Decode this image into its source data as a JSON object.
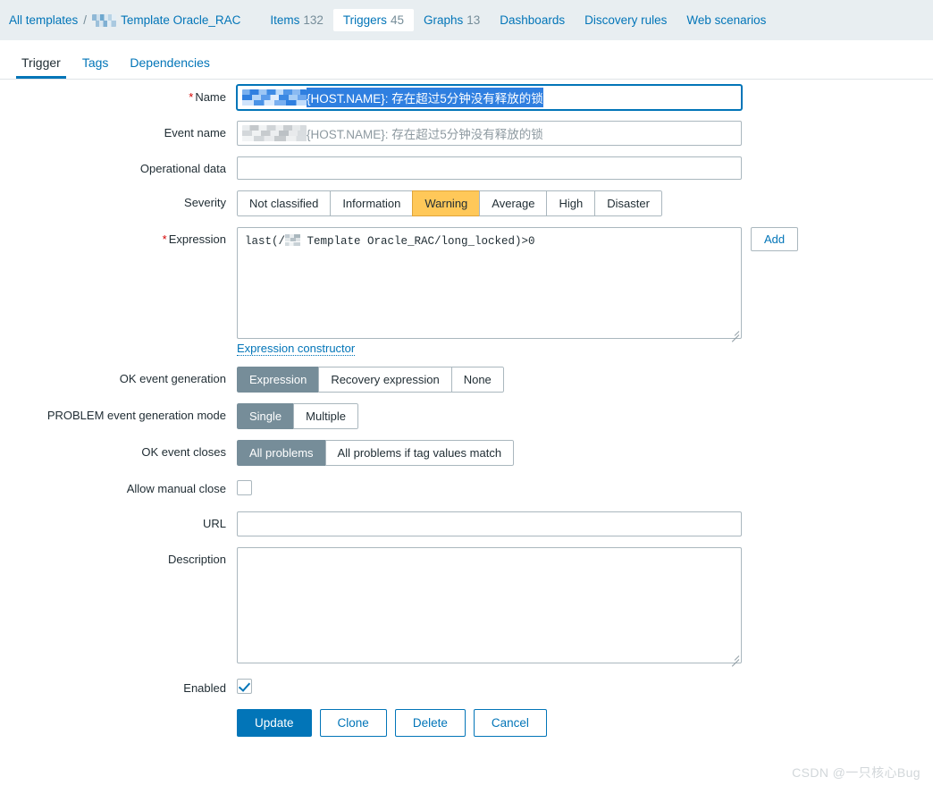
{
  "breadcrumb": {
    "all_templates_label": "All templates",
    "separator": "/",
    "template_name": "Template Oracle_RAC",
    "redacted_icon": "blurred-redaction-block"
  },
  "object_tabs": [
    {
      "label": "Items",
      "count": "132",
      "active": false
    },
    {
      "label": "Triggers",
      "count": "45",
      "active": true
    },
    {
      "label": "Graphs",
      "count": "13",
      "active": false
    },
    {
      "label": "Dashboards",
      "count": "",
      "active": false
    },
    {
      "label": "Discovery rules",
      "count": "",
      "active": false
    },
    {
      "label": "Web scenarios",
      "count": "",
      "active": false
    }
  ],
  "form_tabs": [
    {
      "label": "Trigger",
      "active": true
    },
    {
      "label": "Tags",
      "active": false
    },
    {
      "label": "Dependencies",
      "active": false
    }
  ],
  "form": {
    "name": {
      "label": "Name",
      "required": true,
      "selected_value": "{HOST.NAME}: 存在超过5分钟没有释放的锁",
      "redacted_prefix": "blurred-redaction-block"
    },
    "event_name": {
      "label": "Event name",
      "placeholder_value": "{HOST.NAME}: 存在超过5分钟没有释放的锁",
      "redacted_prefix": "blurred-redaction-block"
    },
    "operational_data": {
      "label": "Operational data",
      "value": ""
    },
    "severity": {
      "label": "Severity",
      "options": [
        "Not classified",
        "Information",
        "Warning",
        "Average",
        "High",
        "Disaster"
      ],
      "selected": "Warning",
      "selected_color": "#ffc859"
    },
    "expression": {
      "label": "Expression",
      "required": true,
      "value_prefix": "last(/",
      "redacted_host": "blurred-redaction-block",
      "value_suffix": " Template Oracle_RAC/long_locked)>0",
      "add_button_label": "Add",
      "constructor_link": "Expression constructor"
    },
    "ok_event_generation": {
      "label": "OK event generation",
      "options": [
        "Expression",
        "Recovery expression",
        "None"
      ],
      "selected": "Expression"
    },
    "problem_event_generation_mode": {
      "label": "PROBLEM event generation mode",
      "options": [
        "Single",
        "Multiple"
      ],
      "selected": "Single"
    },
    "ok_event_closes": {
      "label": "OK event closes",
      "options": [
        "All problems",
        "All problems if tag values match"
      ],
      "selected": "All problems"
    },
    "allow_manual_close": {
      "label": "Allow manual close",
      "checked": false
    },
    "url": {
      "label": "URL",
      "value": ""
    },
    "description": {
      "label": "Description",
      "value": ""
    },
    "enabled": {
      "label": "Enabled",
      "checked": true
    }
  },
  "footer": {
    "update_label": "Update",
    "clone_label": "Clone",
    "delete_label": "Delete",
    "cancel_label": "Cancel"
  },
  "watermark": "CSDN @一只核心Bug",
  "colors": {
    "accent": "#0275b8",
    "header_band": "#e8eef1",
    "selected_segment": "#768d99",
    "warning": "#ffc859",
    "selection_highlight": "#2f7fe0",
    "required_mark": "#d40000"
  }
}
